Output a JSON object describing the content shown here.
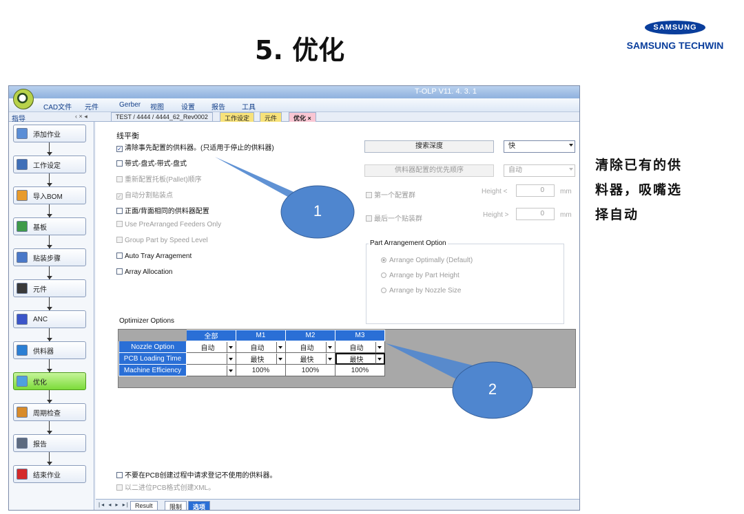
{
  "slide": {
    "title": "5. 优化",
    "brand_logo": "SAMSUNG",
    "brand_name": "SAMSUNG TECHWIN",
    "note_lines": [
      "清除已有的供",
      "料器，吸嘴选",
      "择自动"
    ],
    "callouts": [
      "1",
      "2"
    ]
  },
  "app": {
    "title": "T-OLP V11. 4. 3. 1",
    "menu": [
      "CAD文件",
      "元件",
      "Gerber",
      "视图",
      "设置",
      "报告",
      "工具"
    ],
    "nav_label": "指导",
    "nav_controls": "‹ ×  ◂",
    "doc_tabs": [
      {
        "label": "TEST / 4444 / 4444_62_Rev0002",
        "color": "#ffffff"
      },
      {
        "label": "工作设定",
        "color": "#f7e27a"
      },
      {
        "label": "元件",
        "color": "#f7e27a"
      },
      {
        "label": "优化 ×",
        "color": "#f9c6d3"
      }
    ]
  },
  "sidebar": {
    "items": [
      {
        "label": "添加作业",
        "icon": "add-job-icon",
        "color": "#5b8ed6"
      },
      {
        "label": "工作设定",
        "icon": "work-setting-icon",
        "color": "#3f6fb8"
      },
      {
        "label": "导入BOM",
        "icon": "import-bom-icon",
        "color": "#e89b2c"
      },
      {
        "label": "基板",
        "icon": "board-icon",
        "color": "#3f9a4a"
      },
      {
        "label": "贴装步骤",
        "icon": "mount-step-icon",
        "color": "#4a78c8"
      },
      {
        "label": "元件",
        "icon": "component-icon",
        "color": "#3a3a3a"
      },
      {
        "label": "ANC",
        "icon": "anc-icon",
        "color": "#3b55c9"
      },
      {
        "label": "供料器",
        "icon": "feeder-icon",
        "color": "#2b7fd4"
      },
      {
        "label": "优化",
        "icon": "optimize-icon",
        "color": "#4fa0e0"
      },
      {
        "label": "周期检查",
        "icon": "cycle-check-icon",
        "color": "#d88b2a"
      },
      {
        "label": "报告",
        "icon": "report-icon",
        "color": "#5d6b80"
      },
      {
        "label": "结束作业",
        "icon": "end-job-icon",
        "color": "#d42a2a"
      }
    ],
    "active_index": 8
  },
  "main": {
    "section_title": "线平衡",
    "options": [
      {
        "label": "清除事先配置的供料器。(只适用于停止的供料器)",
        "checked": true,
        "enabled": true
      },
      {
        "label": "带式-盘式-带式-盘式",
        "checked": false,
        "enabled": true
      },
      {
        "label": "重新配置托板(Pallet)顺序",
        "checked": false,
        "enabled": false
      },
      {
        "label": "自动分割贴装点",
        "checked": true,
        "enabled": false
      },
      {
        "label": "正面/背面相同的供料器配置",
        "checked": false,
        "enabled": true
      },
      {
        "label": "Use PreArranged Feeders Only",
        "checked": false,
        "enabled": false
      },
      {
        "label": "Group Part by Speed Level",
        "checked": false,
        "enabled": false
      },
      {
        "label": "Auto Tray Arragement",
        "checked": false,
        "enabled": true
      },
      {
        "label": "Array Allocation",
        "checked": false,
        "enabled": true
      }
    ],
    "search_depth_label": "搜索深度",
    "search_depth_value": "快",
    "feeder_priority_label": "供料器配置的优先顺序",
    "feeder_priority_value": "自动",
    "first_group_label": "第一个配置群",
    "last_group_label": "最后一个贴装群",
    "height_lt": "Height <",
    "height_gt": "Height >",
    "height_first": "0",
    "height_last": "0",
    "unit": "mm",
    "part_arrangement": {
      "title": "Part Arrangement Option",
      "options": [
        "Arrange Optimally (Default)",
        "Arrange by Part Height",
        "Arrange by Nozzle Size"
      ],
      "selected": 0
    },
    "optimizer": {
      "title": "Optimizer Options",
      "columns": [
        "全部",
        "M1",
        "M2",
        "M3"
      ],
      "rows": [
        {
          "label": "Nozzle Option",
          "cells": [
            "自动",
            "自动",
            "自动",
            "自动"
          ]
        },
        {
          "label": "PCB Loading Time",
          "cells": [
            "",
            "最快",
            "最快",
            "最快"
          ]
        },
        {
          "label": "Machine Efficiency",
          "cells": [
            "",
            "100%",
            "100%",
            "100%"
          ]
        }
      ]
    },
    "bottom_options": [
      {
        "label": "不要在PCB创建过程中请求登记不使用的供料器。",
        "enabled": true
      },
      {
        "label": "以二进位PCB格式创建XML。",
        "enabled": false
      }
    ]
  },
  "statusbar": {
    "nav": "|◂ ◂ ▸ ▸|",
    "tabs": [
      "Result",
      "限制",
      "选项"
    ],
    "active": 2
  }
}
